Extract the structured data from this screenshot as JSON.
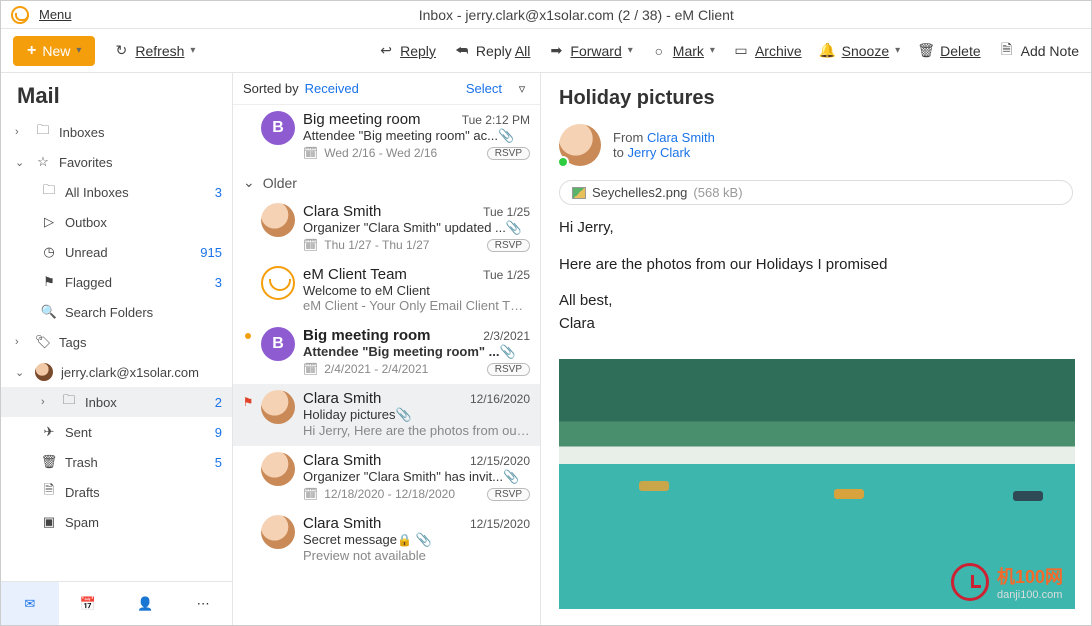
{
  "menu": {
    "label": "Menu"
  },
  "window_title": "Inbox - jerry.clark@x1solar.com (2 / 38) - eM Client",
  "toolbar": {
    "new": "New",
    "refresh": "Refresh",
    "reply": "Reply",
    "reply_all": "Reply All",
    "forward": "Forward",
    "mark": "Mark",
    "archive": "Archive",
    "snooze": "Snooze",
    "delete": "Delete",
    "add_note": "Add Note"
  },
  "sidebar": {
    "title": "Mail",
    "inboxes": "Inboxes",
    "favorites": "Favorites",
    "fav_items": [
      {
        "label": "All Inboxes",
        "count": "3"
      },
      {
        "label": "Outbox",
        "count": ""
      },
      {
        "label": "Unread",
        "count": "915"
      },
      {
        "label": "Flagged",
        "count": "3"
      },
      {
        "label": "Search Folders",
        "count": ""
      }
    ],
    "tags": "Tags",
    "account": "jerry.clark@x1solar.com",
    "folders": [
      {
        "label": "Inbox",
        "count": "2"
      },
      {
        "label": "Sent",
        "count": "9"
      },
      {
        "label": "Trash",
        "count": "5"
      },
      {
        "label": "Drafts",
        "count": ""
      },
      {
        "label": "Spam",
        "count": ""
      }
    ]
  },
  "list": {
    "sorted_by": "Sorted by",
    "sorted_field": "Received",
    "select_label": "Select",
    "older": "Older",
    "messages": [
      {
        "from": "Big meeting room",
        "date": "Tue 2:12 PM",
        "subject": "Attendee \"Big meeting room\" ac...",
        "range": "Wed 2/16 - Wed 2/16",
        "rsvp": "RSVP",
        "av": "B"
      },
      {
        "from": "Clara Smith",
        "date": "Tue 1/25",
        "subject": "Organizer \"Clara Smith\" updated ...",
        "range": "Thu 1/27 - Thu 1/27",
        "rsvp": "RSVP"
      },
      {
        "from": "eM Client Team",
        "date": "Tue 1/25",
        "subject": "Welcome to eM Client",
        "preview": "eM Client - Your Only Email Client Thank..."
      },
      {
        "from": "Big meeting room",
        "date": "2/3/2021",
        "subject": "Attendee \"Big meeting room\" ...",
        "range": "2/4/2021 - 2/4/2021",
        "rsvp": "RSVP",
        "av": "B"
      },
      {
        "from": "Clara Smith",
        "date": "12/16/2020",
        "subject": "Holiday pictures",
        "preview": "Hi Jerry, Here are the photos from our H..."
      },
      {
        "from": "Clara Smith",
        "date": "12/15/2020",
        "subject": "Organizer \"Clara Smith\" has invit...",
        "range": "12/18/2020 - 12/18/2020",
        "rsvp": "RSVP"
      },
      {
        "from": "Clara Smith",
        "date": "12/15/2020",
        "subject": "Secret message",
        "preview": "Preview not available"
      }
    ]
  },
  "reader": {
    "title": "Holiday pictures",
    "from_label": "From",
    "from_name": "Clara Smith",
    "to_label": "to",
    "to_name": "Jerry Clark",
    "attachment": "Seychelles2.png",
    "attachment_size": "(568 kB)",
    "body_p1": "Hi Jerry,",
    "body_p2": "Here are the photos from our Holidays I promised",
    "body_p3": "All best,",
    "body_p4": "Clara"
  },
  "watermark": {
    "main": "机100网",
    "sub": "danji100.com"
  }
}
